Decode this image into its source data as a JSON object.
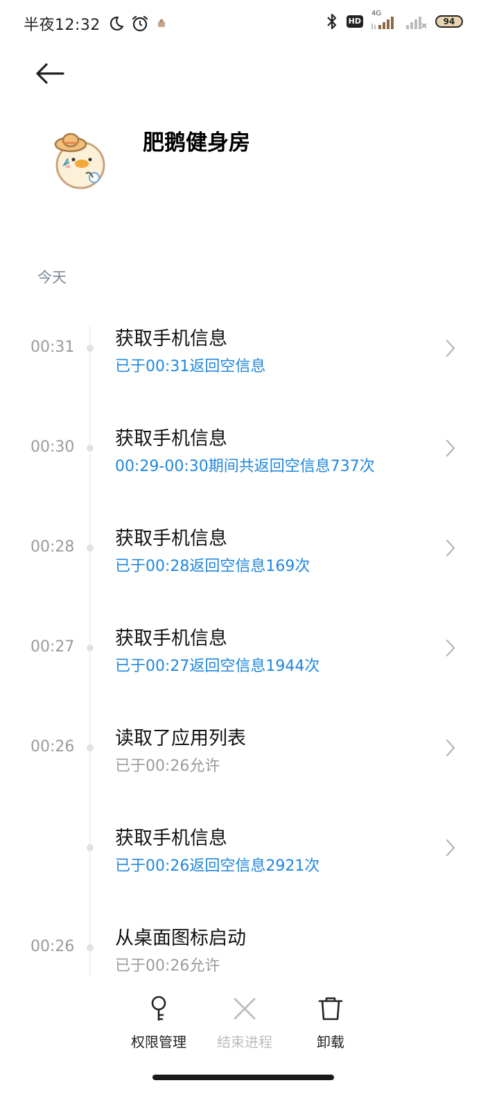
{
  "status_bar": {
    "time": "半夜12:32",
    "icons_left": [
      "moon-icon",
      "alarm-icon",
      "notification-icon"
    ],
    "icons_right": [
      "bluetooth-icon",
      "hd-badge",
      "signal-4g-icon",
      "signal-icon"
    ],
    "hd_label": "HD",
    "network_label": "4G",
    "battery": "94"
  },
  "header": {
    "app_name": "肥鹅健身房"
  },
  "section": {
    "title": "今天"
  },
  "entries": [
    {
      "time": "00:31",
      "title": "获取手机信息",
      "subtitle": "已于00:31返回空信息",
      "subtitle_color": "blue",
      "has_chevron": true
    },
    {
      "time": "00:30",
      "title": "获取手机信息",
      "subtitle": "00:29-00:30期间共返回空信息737次",
      "subtitle_color": "blue",
      "has_chevron": true
    },
    {
      "time": "00:28",
      "title": "获取手机信息",
      "subtitle": "已于00:28返回空信息169次",
      "subtitle_color": "blue",
      "has_chevron": true
    },
    {
      "time": "00:27",
      "title": "获取手机信息",
      "subtitle": "已于00:27返回空信息1944次",
      "subtitle_color": "blue",
      "has_chevron": true
    },
    {
      "time": "00:26",
      "title": "读取了应用列表",
      "subtitle": "已于00:26允许",
      "subtitle_color": "gray",
      "has_chevron": true
    },
    {
      "time": "",
      "title": "获取手机信息",
      "subtitle": "已于00:26返回空信息2921次",
      "subtitle_color": "blue",
      "has_chevron": true
    },
    {
      "time": "00:26",
      "title": "从桌面图标启动",
      "subtitle": "已于00:26允许",
      "subtitle_color": "gray",
      "has_chevron": false
    }
  ],
  "actions": {
    "permissions": {
      "label": "权限管理",
      "icon": "key-icon",
      "enabled": true
    },
    "end_process": {
      "label": "结束进程",
      "icon": "close-icon",
      "enabled": false
    },
    "uninstall": {
      "label": "卸载",
      "icon": "trash-icon",
      "enabled": true
    }
  },
  "colors": {
    "accent_blue": "#1f86de",
    "muted_gray": "#9b9b9b",
    "section_gray": "#7a8597",
    "disabled_gray": "#bdbdbd"
  }
}
